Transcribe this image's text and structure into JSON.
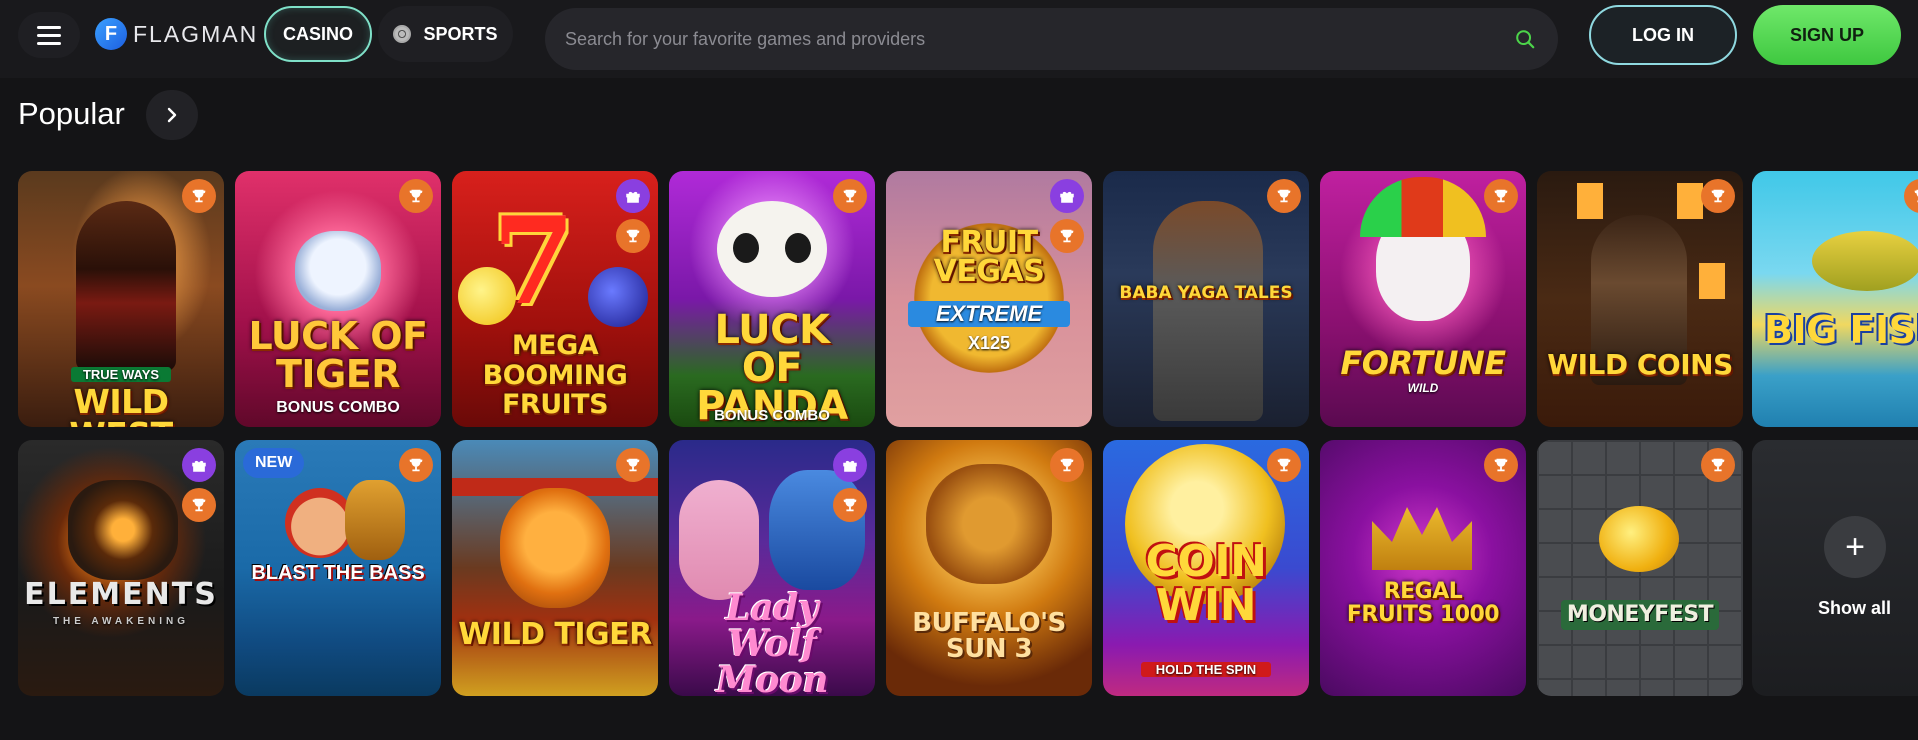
{
  "header": {
    "brand": "FLAGMAN",
    "brand_letter": "F",
    "nav": {
      "casino": "CASINO",
      "sports": "SPORTS"
    },
    "search_placeholder": "Search for your favorite games and providers",
    "login": "LOG IN",
    "signup": "SIGN UP"
  },
  "section": {
    "title": "Popular"
  },
  "show_all": {
    "label": "Show all",
    "icon": "+"
  },
  "games": [
    {
      "title": "WILD WEST",
      "tag": "TRUE WAYS",
      "badges": [
        "trophy"
      ]
    },
    {
      "title": "LUCK OF TIGER",
      "subtitle": "BONUS COMBO",
      "badges": [
        "trophy"
      ]
    },
    {
      "title": "MEGA BOOMING FRUITS",
      "badges": [
        "gift",
        "trophy"
      ]
    },
    {
      "title": "LUCK OF PANDA",
      "subtitle": "BONUS COMBO",
      "badges": [
        "trophy"
      ]
    },
    {
      "title": "FRUIT VEGAS",
      "subtitle": "EXTREME",
      "extra": "X125",
      "badges": [
        "gift",
        "trophy"
      ]
    },
    {
      "title": "BABA YAGA TALES",
      "badges": [
        "trophy"
      ]
    },
    {
      "title": "FORTUNE",
      "subtitle": "WILD",
      "badges": [
        "trophy"
      ]
    },
    {
      "title": "WILD COINS",
      "badges": [
        "trophy"
      ]
    },
    {
      "title": "BIG FISH",
      "badges": [
        "trophy"
      ]
    },
    {
      "title": "ELEMENTS",
      "subtitle": "THE AWAKENING",
      "badges": [
        "gift",
        "trophy"
      ]
    },
    {
      "title": "BLAST THE BASS",
      "label": "NEW",
      "badges": [
        "trophy"
      ]
    },
    {
      "title": "WILD TIGER",
      "badges": [
        "trophy"
      ]
    },
    {
      "title": "Lady Wolf Moon",
      "badges": [
        "gift",
        "trophy"
      ]
    },
    {
      "title": "BUFFALO'S SUN 3",
      "badges": [
        "trophy"
      ]
    },
    {
      "title": "COIN WIN",
      "subtitle": "HOLD THE SPIN",
      "badges": [
        "trophy"
      ]
    },
    {
      "title": "REGAL FRUITS 1000",
      "badges": [
        "trophy"
      ]
    },
    {
      "title": "MONEYFEST",
      "badges": [
        "trophy"
      ]
    }
  ],
  "colors": {
    "accent_green": "#4cd44a",
    "trophy": "#e8742a",
    "gift": "#8a3fe0",
    "new": "#2a6ad8"
  }
}
